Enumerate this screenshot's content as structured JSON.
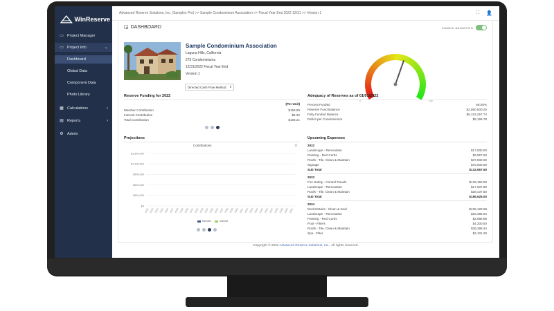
{
  "app": {
    "name": "WinReserve"
  },
  "breadcrumb": "Advanced Reserve Solutions, Inc. (Samples Pro) >> Sample Condominium Association >> Fiscal Year End 2022 12/31 >> Version 1",
  "sidebar": {
    "items": [
      {
        "label": "Project Manager",
        "icon": "folder-icon"
      },
      {
        "label": "Project Info",
        "icon": "folder-open-icon"
      },
      {
        "label": "Calculations",
        "icon": "calculator-icon"
      },
      {
        "label": "Reports",
        "icon": "file-icon"
      },
      {
        "label": "Admin",
        "icon": "gear-icon"
      }
    ],
    "subitems": [
      "Dashboard",
      "Global Data",
      "Component Data",
      "Photo Library"
    ]
  },
  "dashboard": {
    "title": "DASHBOARD",
    "animation_label": "ENABLE ANIMATION",
    "animation_on": true
  },
  "property": {
    "name": "Sample Condominium Association",
    "location": "Laguna Hills, California",
    "units": "275 Condominiums",
    "fiscal": "12/31/2022 Fiscal Year End",
    "version": "Version 1",
    "method": "Directed Cash Flow Method"
  },
  "gauge": {
    "percent_funded": 58.05
  },
  "funding": {
    "title": "Reserve Funding for 2022",
    "col_header": "(Per Unit)",
    "rows": [
      {
        "label": "Member Contribution",
        "value": "$159.89"
      },
      {
        "label": "Interest Contribution",
        "value": "$6.32"
      },
      {
        "label": "Total Contribution",
        "value": "$166.21"
      }
    ]
  },
  "adequacy": {
    "title": "Adequacy of Reserves as of 01/01/2022",
    "rows": [
      {
        "label": "Percent Funded",
        "value": "58.05%"
      },
      {
        "label": "Reserve Fund Balance",
        "value": "$2,860,500.00"
      },
      {
        "label": "Fully Funded Balance",
        "value": "$5,153,257.74"
      },
      {
        "label": "Deficit per Condominium",
        "value": "$8,166.78"
      }
    ]
  },
  "projections": {
    "title": "Projections",
    "chart_title": "Contributions",
    "legend": [
      "Member",
      "Interest"
    ]
  },
  "chart_data": {
    "type": "bar",
    "title": "Contributions",
    "yticks": [
      "$1,500,000",
      "$1,200,000",
      "$900,000",
      "$600,000",
      "$300,000",
      "$0"
    ],
    "categories": [
      "2022",
      "2023",
      "2024",
      "2025",
      "2026",
      "2027",
      "2028",
      "2029",
      "2030",
      "2031",
      "2032",
      "2033",
      "2034",
      "2035",
      "2036",
      "2037",
      "2038",
      "2039",
      "2040",
      "2041",
      "2042",
      "2043",
      "2044",
      "2045",
      "2046",
      "2047",
      "2048",
      "2049",
      "2050",
      "2051"
    ],
    "series": [
      {
        "name": "Member",
        "values": []
      },
      {
        "name": "Interest",
        "values": []
      }
    ],
    "colors": {
      "Member": "#4a5a8a",
      "Interest": "#9ccf6a"
    }
  },
  "expenses": {
    "title": "Upcoming Expenses",
    "groups": [
      {
        "year": "2022",
        "items": [
          {
            "label": "Landscape - Renovation",
            "value": "$17,500.00"
          },
          {
            "label": "Painting - Red Curbs",
            "value": "$2,557.50"
          },
          {
            "label": "Roofs - Tile, Clean & Maintain",
            "value": "$37,500.00"
          },
          {
            "label": "Signage",
            "value": "$75,000.00"
          }
        ],
        "subtotal": "$132,557.50"
      },
      {
        "year": "2023",
        "items": [
          {
            "label": "Fire Safety - Control Panels",
            "value": "$129,150.00"
          },
          {
            "label": "Landscape - Renovation",
            "value": "$17,937.50"
          },
          {
            "label": "Roofs - Tile, Clean & Maintain",
            "value": "$38,437.50"
          }
        ],
        "subtotal": "$185,525.00"
      },
      {
        "year": "2024",
        "items": [
          {
            "label": "Decks/Stairs - Clean & Seal",
            "value": "$109,126.58"
          },
          {
            "label": "Landscape - Renovation",
            "value": "$18,385.94"
          },
          {
            "label": "Painting - Red Curbs",
            "value": "$2,686.88"
          },
          {
            "label": "Pool - Filters",
            "value": "$4,200.50"
          },
          {
            "label": "Roofs - Tile, Clean & Maintain",
            "value": "$39,398.44"
          },
          {
            "label": "Spa - Filter",
            "value": "$2,101.25"
          }
        ]
      }
    ],
    "subtotal_label": "Sub Total"
  },
  "footer": {
    "prefix": "Copyright © 2022 ",
    "company": "Advanced Reserve Solutions, Inc.",
    "suffix": ", All rights reserved."
  }
}
